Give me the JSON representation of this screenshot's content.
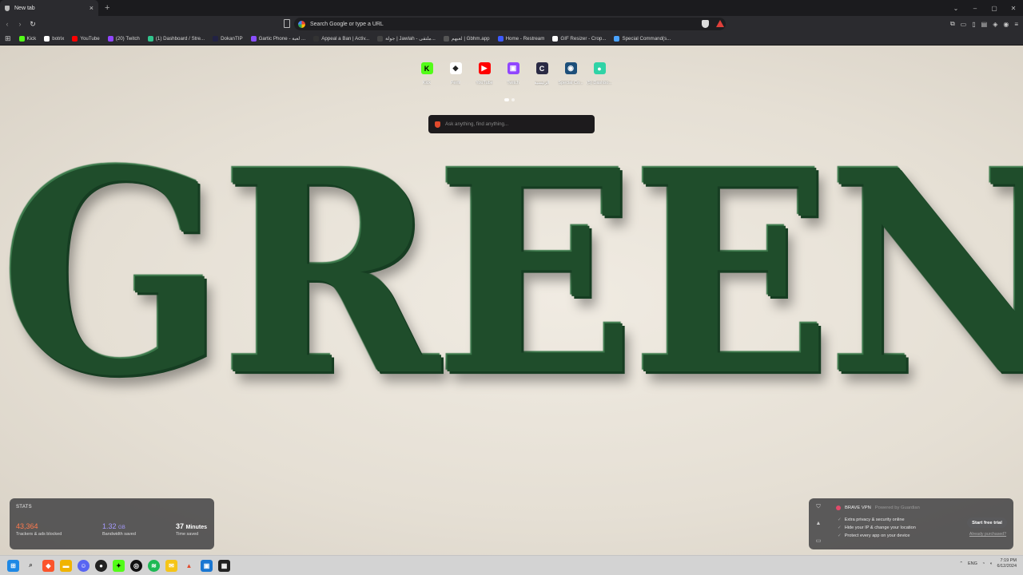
{
  "tab": {
    "title": "New tab",
    "close": "×",
    "new": "+"
  },
  "window": {
    "minimize": "–",
    "maximize": "▢",
    "close": "✕",
    "dropdown": "⌄"
  },
  "omnibox": {
    "placeholder": "Search Google or type a URL"
  },
  "bookmarks": [
    {
      "label": "Kick",
      "color": "#53fc18"
    },
    {
      "label": "botrix",
      "color": "#ffffff"
    },
    {
      "label": "YouTube",
      "color": "#ff0000"
    },
    {
      "label": "(20) Twitch",
      "color": "#9146ff"
    },
    {
      "label": "(1) Dashboard / Stre...",
      "color": "#31c48d"
    },
    {
      "label": "DokanTIP",
      "color": "#222244"
    },
    {
      "label": "Gartic Phone - لعبة ...",
      "color": "#8a4fff"
    },
    {
      "label": "Appeal a Ban | Activ...",
      "color": "#333333"
    },
    {
      "label": "جولة | Jawlah - ملتقى...",
      "color": "#444444"
    },
    {
      "label": "لعبهم | Gbhm.app",
      "color": "#555555"
    },
    {
      "label": "Home - Restream",
      "color": "#3d5afe"
    },
    {
      "label": "GIF Resizer - Crop...",
      "color": "#ffffff"
    },
    {
      "label": "Special Command(s...",
      "color": "#4aa3ff"
    }
  ],
  "top_sites": [
    {
      "label": "Kick",
      "glyph": "K",
      "color": "#53fc18",
      "fg": "#000"
    },
    {
      "label": "Perfil",
      "glyph": "◆",
      "color": "#ffffff",
      "fg": "#222"
    },
    {
      "label": "YouTube",
      "glyph": "▶",
      "color": "#ff0000",
      "fg": "#fff"
    },
    {
      "label": "Twitch",
      "glyph": "▣",
      "color": "#9146ff",
      "fg": "#fff"
    },
    {
      "label": "الرئيسية",
      "glyph": "C",
      "color": "#2a2a44",
      "fg": "#fff"
    },
    {
      "label": "Special Co...",
      "glyph": "◉",
      "color": "#1d4f7a",
      "fg": "#fff"
    },
    {
      "label": "(5) Dashbo...",
      "glyph": "●",
      "color": "#2fd3a6",
      "fg": "#fff"
    }
  ],
  "search": {
    "placeholder": "Ask anything, find anything..."
  },
  "stats": {
    "title": "STATS",
    "trackers": "43,364",
    "trackers_label": "Trackers & ads blocked",
    "bandwidth": "1.32",
    "bandwidth_unit": "GB",
    "bandwidth_label": "Bandwidth saved",
    "time": "37",
    "time_unit": "Minutes",
    "time_label": "Time saved"
  },
  "vpn": {
    "title": "BRAVE VPN",
    "powered": "Powered by Guardian",
    "features": [
      "Extra privacy & security online",
      "Hide your IP & change your location",
      "Protect every app on your device"
    ],
    "cta": "Start free trial",
    "already": "Already purchased?"
  },
  "tray": {
    "lang": "ENG",
    "time": "7:19 PM",
    "date": "6/12/2024"
  }
}
